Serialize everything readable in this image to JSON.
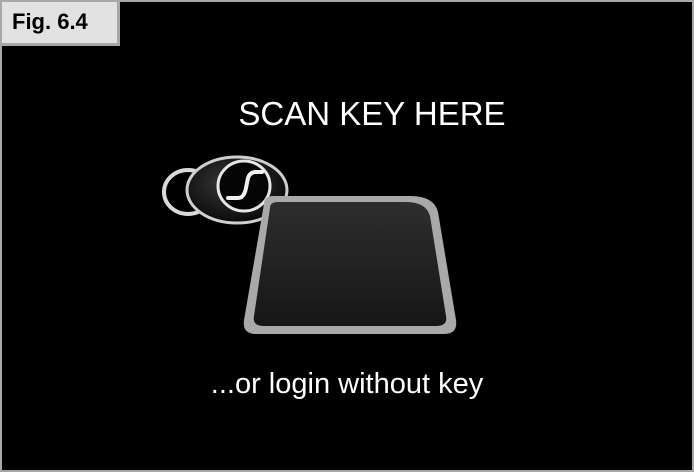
{
  "figure": {
    "label": "Fig. 6.4"
  },
  "screen": {
    "title": "SCAN KEY HERE",
    "login_link": "...or login without key",
    "background_color": "#000000",
    "text_color": "#ffffff"
  },
  "icons": {
    "key_fob": "key-fob-icon",
    "reader_pad": "card-reader-pad-icon"
  }
}
